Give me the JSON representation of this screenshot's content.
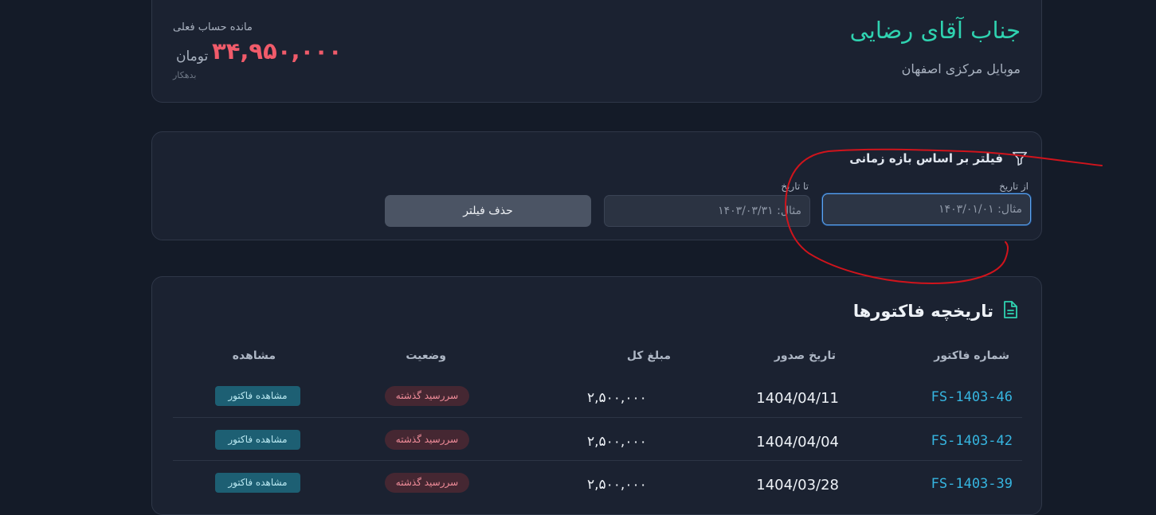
{
  "account": {
    "customer_name": "جناب آقای رضایی",
    "customer_subtitle": "موبایل مرکزی اصفهان",
    "balance_label": "مانده حساب فعلی",
    "balance_amount": "۳۴,۹۵۰,۰۰۰",
    "balance_currency": "تومان",
    "balance_status": "بدهکار",
    "balance_color": "#f05b6a",
    "name_color": "#2fd2b0"
  },
  "filter": {
    "title": "فیلتر بر اساس بازه زمانی",
    "icon": "filter-icon",
    "from_label": "از تاریخ",
    "from_placeholder": "مثال: ۱۴۰۳/۰۱/۰۱",
    "to_label": "تا تاریخ",
    "to_placeholder": "مثال: ۱۴۰۳/۰۳/۳۱",
    "clear_label": "حذف فیلتر"
  },
  "invoices": {
    "title": "تاریخچه فاکتورها",
    "icon": "document-icon",
    "columns": {
      "number": "شماره فاکتور",
      "date": "تاریخ صدور",
      "amount": "مبلغ کل",
      "status": "وضعیت",
      "view": "مشاهده"
    },
    "rows": [
      {
        "number": "FS-1403-46",
        "date": "1404/04/11",
        "amount": "۲,۵۰۰,۰۰۰",
        "status": "سررسید گذشته",
        "action": "مشاهده فاکتور"
      },
      {
        "number": "FS-1403-42",
        "date": "1404/04/04",
        "amount": "۲,۵۰۰,۰۰۰",
        "status": "سررسید گذشته",
        "action": "مشاهده فاکتور"
      },
      {
        "number": "FS-1403-39",
        "date": "1404/03/28",
        "amount": "۲,۵۰۰,۰۰۰",
        "status": "سررسید گذشته",
        "action": "مشاهده فاکتور"
      }
    ]
  },
  "annotation": {
    "color": "#d0141c"
  }
}
